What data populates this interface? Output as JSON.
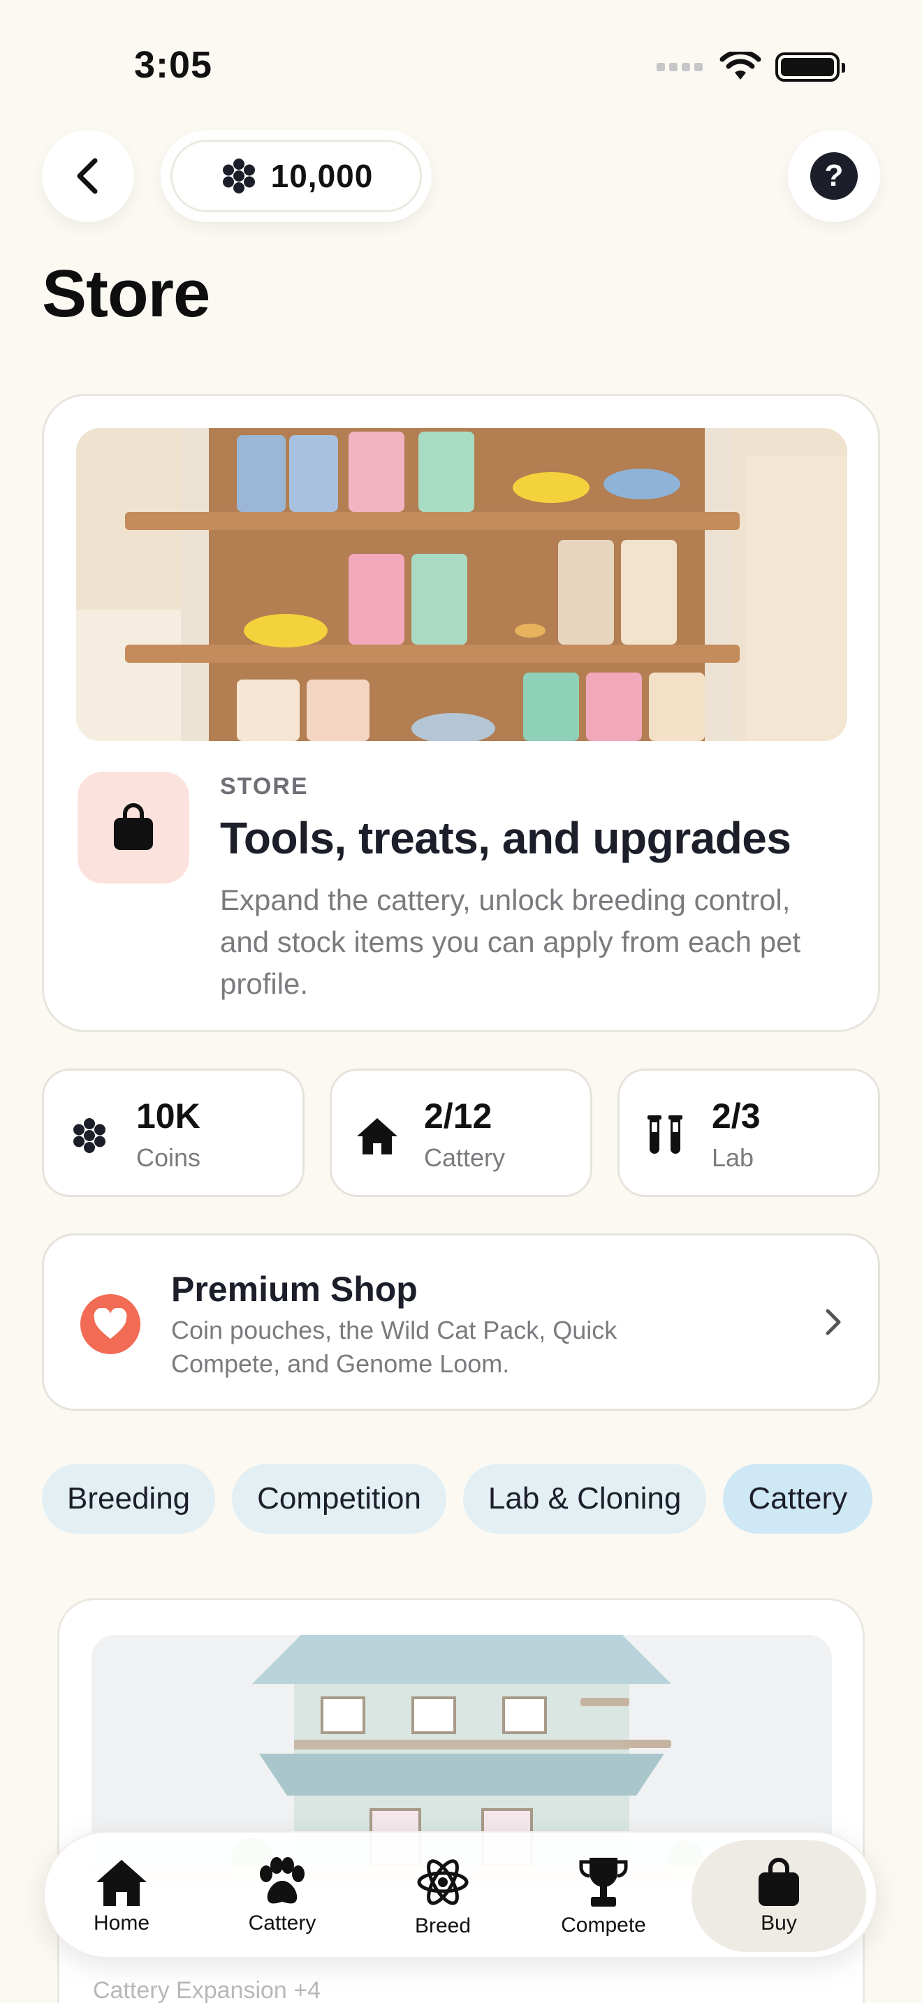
{
  "status_bar": {
    "time": "3:05"
  },
  "header": {
    "coin_balance": "10,000"
  },
  "page": {
    "title": "Store"
  },
  "hero": {
    "eyebrow": "STORE",
    "title": "Tools, treats, and upgrades",
    "description": "Expand the cattery, unlock breeding control, and stock items you can apply from each pet profile."
  },
  "stats": [
    {
      "value": "10K",
      "label": "Coins",
      "icon": "paw-coin-icon"
    },
    {
      "value": "2/12",
      "label": "Cattery",
      "icon": "house-icon"
    },
    {
      "value": "2/3",
      "label": "Lab",
      "icon": "test-tubes-icon"
    }
  ],
  "premium": {
    "title": "Premium Shop",
    "subtitle": "Coin pouches, the Wild Cat Pack, Quick Compete, and Genome Loom."
  },
  "chips": [
    "Breeding",
    "Competition",
    "Lab & Cloning",
    "Cattery"
  ],
  "product": {
    "caption": "Cattery Expansion +4"
  },
  "tabs": [
    {
      "label": "Home",
      "icon": "home-icon"
    },
    {
      "label": "Cattery",
      "icon": "paw-icon"
    },
    {
      "label": "Breed",
      "icon": "atom-icon"
    },
    {
      "label": "Compete",
      "icon": "trophy-icon"
    },
    {
      "label": "Buy",
      "icon": "bag-icon"
    }
  ],
  "colors": {
    "background": "#fcf9f3",
    "accent_coral": "#f26b54",
    "chip_bg": "#e3eff3",
    "icon_dark": "#1c1f2a"
  }
}
